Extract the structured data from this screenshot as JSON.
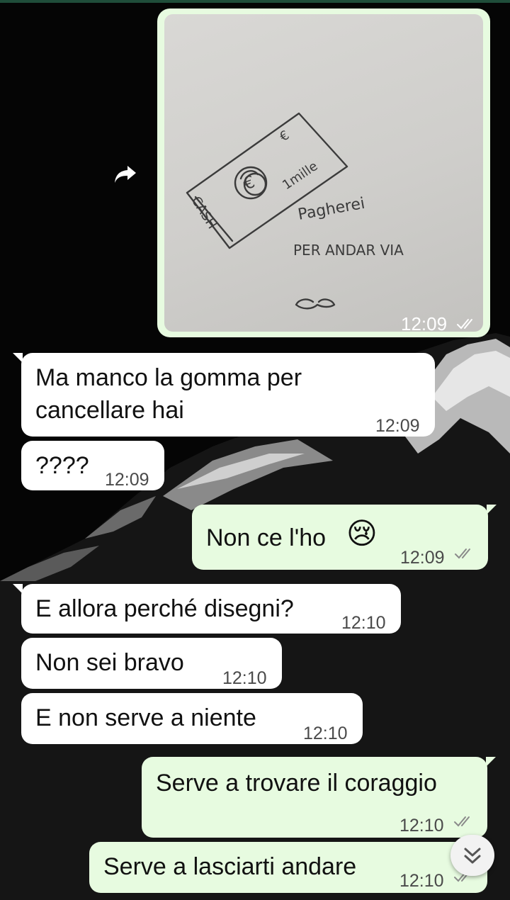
{
  "chat": {
    "image_message": {
      "time": "12:09",
      "sketch": {
        "bill_euro_sign": "€",
        "bill_amount": "1mille",
        "bill_side": "CASH",
        "line1": "Pagherei",
        "line2": "PER ANDAR VIA"
      }
    },
    "messages": [
      {
        "direction": "incoming",
        "text_line1": "Ma manco la gomma per",
        "text_line2": "cancellare hai",
        "time": "12:09"
      },
      {
        "direction": "incoming",
        "text": "????",
        "time": "12:09"
      },
      {
        "direction": "outgoing",
        "text": "Non ce l'ho",
        "emoji": "😢",
        "time": "12:09",
        "read": true
      },
      {
        "direction": "incoming",
        "text": "E allora perché disegni?",
        "time": "12:10"
      },
      {
        "direction": "incoming",
        "text": "Non sei bravo",
        "time": "12:10"
      },
      {
        "direction": "incoming",
        "text": "E non serve a niente",
        "time": "12:10"
      },
      {
        "direction": "outgoing",
        "text": "Serve a trovare il coraggio",
        "time": "12:10",
        "read": true
      },
      {
        "direction": "outgoing",
        "text": "Serve a lasciarti andare",
        "time": "12:10",
        "read": true
      }
    ]
  },
  "icons": {
    "forward": "forward-arrow-icon",
    "read_receipt": "double-check-icon",
    "scroll_down": "chevron-double-down-icon"
  },
  "colors": {
    "outgoing_bubble": "#e7fbe0",
    "incoming_bubble": "#ffffff",
    "wallpaper": "#050505"
  }
}
